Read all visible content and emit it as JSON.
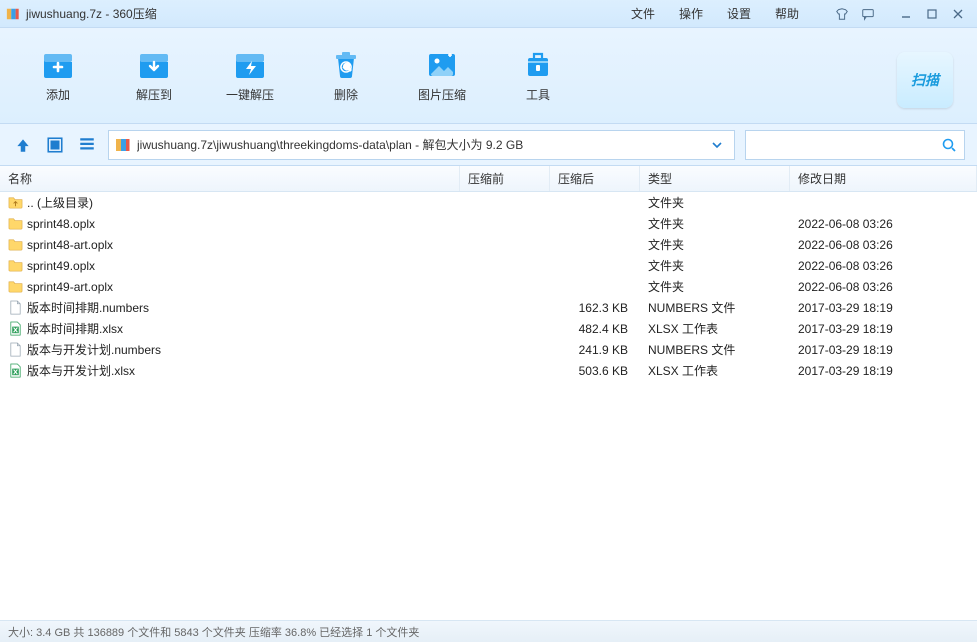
{
  "window": {
    "title": "jiwushuang.7z - 360压缩"
  },
  "menu": {
    "file": "文件",
    "operate": "操作",
    "settings": "设置",
    "help": "帮助"
  },
  "toolbar": {
    "add": "添加",
    "extractTo": "解压到",
    "oneClick": "一键解压",
    "delete": "删除",
    "imgComp": "图片压缩",
    "tools": "工具",
    "scan": "扫描"
  },
  "path": {
    "text": "jiwushuang.7z\\jiwushuang\\threekingdoms-data\\plan - 解包大小为 9.2 GB"
  },
  "search": {
    "placeholder": ""
  },
  "columns": {
    "name": "名称",
    "pre": "压缩前",
    "post": "压缩后",
    "type": "类型",
    "date": "修改日期"
  },
  "rows": [
    {
      "icon": "folder-up",
      "name": ".. (上级目录)",
      "pre": "",
      "post": "",
      "type": "文件夹",
      "date": ""
    },
    {
      "icon": "folder",
      "name": "sprint48.oplx",
      "pre": "",
      "post": "",
      "type": "文件夹",
      "date": "2022-06-08 03:26"
    },
    {
      "icon": "folder",
      "name": "sprint48-art.oplx",
      "pre": "",
      "post": "",
      "type": "文件夹",
      "date": "2022-06-08 03:26"
    },
    {
      "icon": "folder",
      "name": "sprint49.oplx",
      "pre": "",
      "post": "",
      "type": "文件夹",
      "date": "2022-06-08 03:26"
    },
    {
      "icon": "folder",
      "name": "sprint49-art.oplx",
      "pre": "",
      "post": "",
      "type": "文件夹",
      "date": "2022-06-08 03:26"
    },
    {
      "icon": "file",
      "name": "版本时间排期.numbers",
      "pre": "",
      "post": "162.3 KB",
      "type": "NUMBERS 文件",
      "date": "2017-03-29 18:19"
    },
    {
      "icon": "xlsx",
      "name": "版本时间排期.xlsx",
      "pre": "",
      "post": "482.4 KB",
      "type": "XLSX 工作表",
      "date": "2017-03-29 18:19"
    },
    {
      "icon": "file",
      "name": "版本与开发计划.numbers",
      "pre": "",
      "post": "241.9 KB",
      "type": "NUMBERS 文件",
      "date": "2017-03-29 18:19"
    },
    {
      "icon": "xlsx",
      "name": "版本与开发计划.xlsx",
      "pre": "",
      "post": "503.6 KB",
      "type": "XLSX 工作表",
      "date": "2017-03-29 18:19"
    }
  ],
  "status": "大小: 3.4 GB 共 136889 个文件和 5843 个文件夹 压缩率 36.8% 已经选择 1 个文件夹"
}
